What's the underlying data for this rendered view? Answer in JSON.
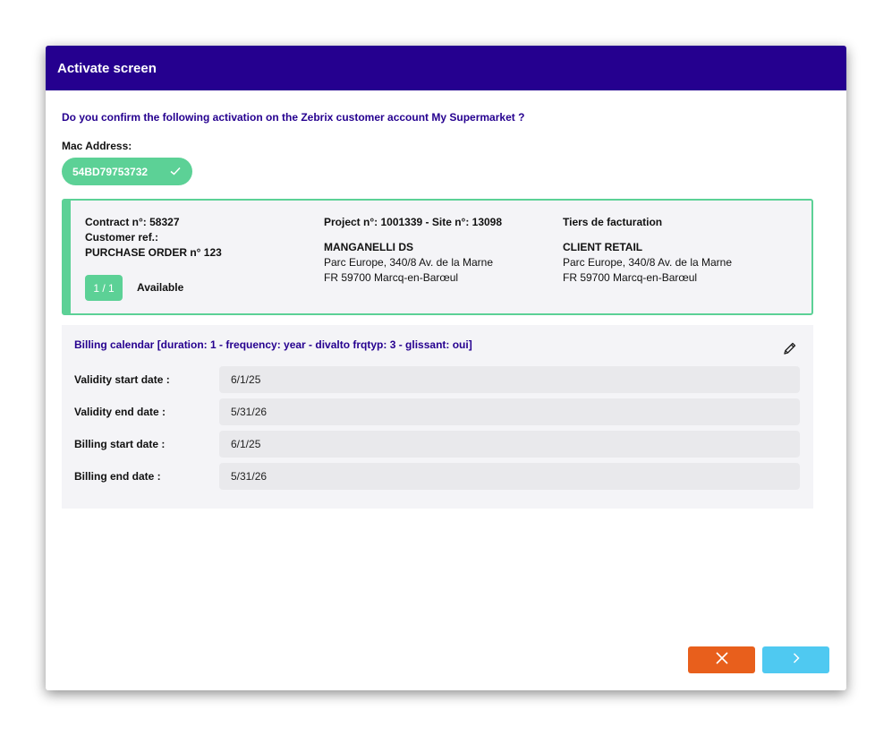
{
  "modal": {
    "title": "Activate screen",
    "question": "Do you confirm the following activation on the Zebrix customer account My Supermarket ?"
  },
  "mac": {
    "label": "Mac Address:",
    "value": "54BD79753732"
  },
  "contract": {
    "contract_line": "Contract n°: 58327",
    "customer_ref_label": "Customer ref.:",
    "purchase_order": "PURCHASE ORDER n° 123",
    "count": "1 / 1",
    "status": "Available",
    "project_line": "Project n°: 1001339 - Site n°: 13098",
    "site_name": "MANGANELLI DS",
    "site_address_1": "Parc Europe, 340/8 Av. de la Marne",
    "site_address_2": "FR 59700 Marcq-en-Barœul",
    "billing_party_label": "Tiers de facturation",
    "billing_party_name": "CLIENT RETAIL",
    "billing_address_1": "Parc Europe, 340/8 Av. de la Marne",
    "billing_address_2": "FR 59700 Marcq-en-Barœul"
  },
  "billing": {
    "title": "Billing calendar [duration: 1 - frequency: year - divalto frqtyp: 3 - glissant: oui]",
    "rows": [
      {
        "label": "Validity start date :",
        "value": "6/1/25"
      },
      {
        "label": "Validity end date :",
        "value": "5/31/26"
      },
      {
        "label": "Billing start date :",
        "value": "6/1/25"
      },
      {
        "label": "Billing end date :",
        "value": "5/31/26"
      }
    ]
  },
  "icons": {
    "check": "check-icon",
    "edit": "pencil-icon",
    "cancel": "close-icon",
    "next": "chevron-right-icon"
  },
  "colors": {
    "header": "#25008f",
    "accent_green": "#5cd196",
    "cancel": "#e85f1c",
    "next": "#4fc9f1"
  }
}
